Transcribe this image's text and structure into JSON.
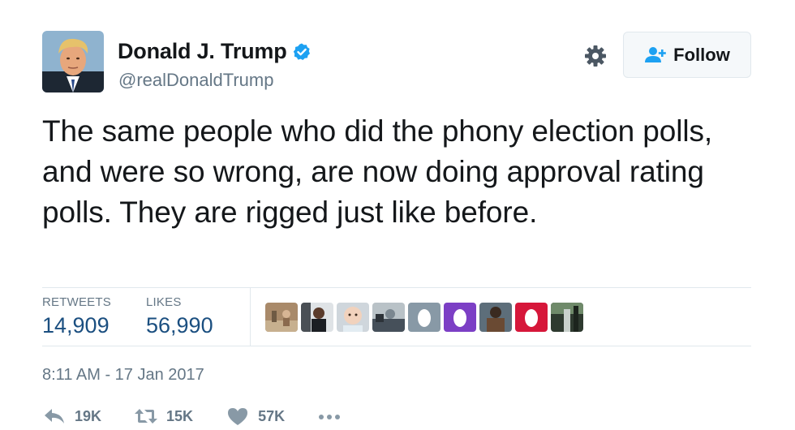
{
  "user": {
    "fullname": "Donald J. Trump",
    "handle": "@realDonaldTrump",
    "avatar_icon": "profile-photo",
    "verified_icon": "verified-badge-icon",
    "verified_color": "#1da1f2"
  },
  "header": {
    "settings_icon": "gear-icon",
    "follow_label": "Follow",
    "follow_icon": "add-user-icon",
    "follow_icon_color": "#1da1f2"
  },
  "tweet": {
    "text": "The same people who did the phony election polls, and were so wrong, are now doing approval rating polls. They are rigged just like before."
  },
  "stats": {
    "retweets_label": "RETWEETS",
    "retweets_value": "14,909",
    "likes_label": "LIKES",
    "likes_value": "56,990",
    "value_color": "#1b4f80"
  },
  "likers": [
    {
      "kind": "photo"
    },
    {
      "kind": "photo"
    },
    {
      "kind": "photo"
    },
    {
      "kind": "photo"
    },
    {
      "kind": "default-egg",
      "color": "#8899a6"
    },
    {
      "kind": "default-egg",
      "color": "#7c3fc5"
    },
    {
      "kind": "photo"
    },
    {
      "kind": "default-egg",
      "color": "#d6173a"
    },
    {
      "kind": "photo"
    }
  ],
  "timestamp": "8:11 AM - 17 Jan 2017",
  "actions": {
    "reply_icon": "reply-icon",
    "reply_count": "19K",
    "retweet_icon": "retweet-icon",
    "retweet_count": "15K",
    "like_icon": "heart-icon",
    "like_count": "57K",
    "more_icon": "more-dots-icon"
  }
}
